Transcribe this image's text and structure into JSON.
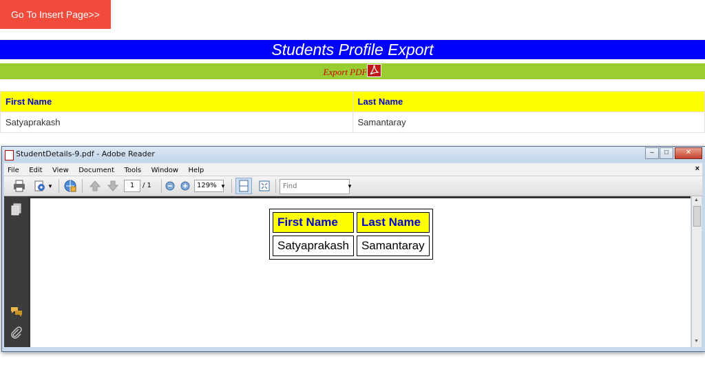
{
  "header": {
    "insert_button_label": "Go To Insert Page>>",
    "title": "Students Profile Export",
    "export_label": "Export PDF"
  },
  "grid": {
    "columns": [
      "First Name",
      "Last Name"
    ],
    "rows": [
      [
        "Satyaprakash",
        "Samantaray"
      ]
    ]
  },
  "reader": {
    "window_title": "StudentDetails-9.pdf - Adobe Reader",
    "menu": [
      "File",
      "Edit",
      "View",
      "Document",
      "Tools",
      "Window",
      "Help"
    ],
    "menu_close": "×",
    "page_current": "1",
    "page_total": "/ 1",
    "zoom": "129%",
    "find_placeholder": "Find"
  },
  "pdf_table": {
    "columns": [
      "First Name",
      "Last Name"
    ],
    "rows": [
      [
        "Satyaprakash",
        "Samantaray"
      ]
    ]
  },
  "colors": {
    "button": "#f24a3b",
    "title_bar": "#0000ff",
    "export_bar": "#9acd32",
    "header_row": "#ffff00",
    "header_text": "#0000cc",
    "export_link": "#cc0000"
  }
}
